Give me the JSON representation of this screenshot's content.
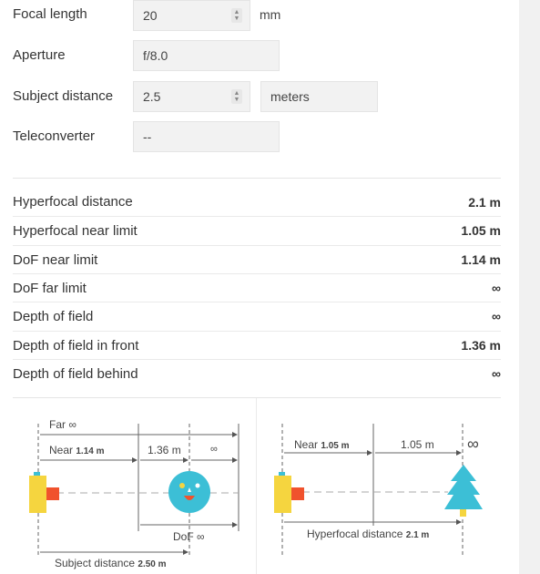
{
  "inputs": {
    "focal_length": {
      "label": "Focal length",
      "value": "20",
      "unit": "mm"
    },
    "aperture": {
      "label": "Aperture",
      "value": "f/8.0"
    },
    "subject_distance": {
      "label": "Subject distance",
      "value": "2.5",
      "unit": "meters"
    },
    "teleconverter": {
      "label": "Teleconverter",
      "value": "--"
    }
  },
  "results": [
    {
      "label": "Hyperfocal distance",
      "value": "2.1 m"
    },
    {
      "label": "Hyperfocal near limit",
      "value": "1.05 m"
    },
    {
      "label": "DoF near limit",
      "value": "1.14 m"
    },
    {
      "label": "DoF far limit",
      "value": "∞"
    },
    {
      "label": "Depth of field",
      "value": "∞"
    },
    {
      "label": "Depth of field in front",
      "value": "1.36 m"
    },
    {
      "label": "Depth of field behind",
      "value": "∞"
    }
  ],
  "diagram_left": {
    "far_label": "Far",
    "far_value": "∞",
    "near_label": "Near",
    "near_value": "1.14 m",
    "front_value": "1.36 m",
    "behind_value": "∞",
    "dof_label": "DoF",
    "dof_value": "∞",
    "subject_label": "Subject distance",
    "subject_value": "2.50 m"
  },
  "diagram_right": {
    "near_label": "Near",
    "near_value": "1.05 m",
    "span_value": "1.05 m",
    "infinity": "∞",
    "hyperfocal_label": "Hyperfocal distance",
    "hyperfocal_value": "2.1 m"
  },
  "colors": {
    "camera_body": "#f5d53f",
    "lens": "#f0522d",
    "face": "#3cbfd6",
    "tree": "#3cbfd6",
    "trunk": "#f5d53f"
  }
}
